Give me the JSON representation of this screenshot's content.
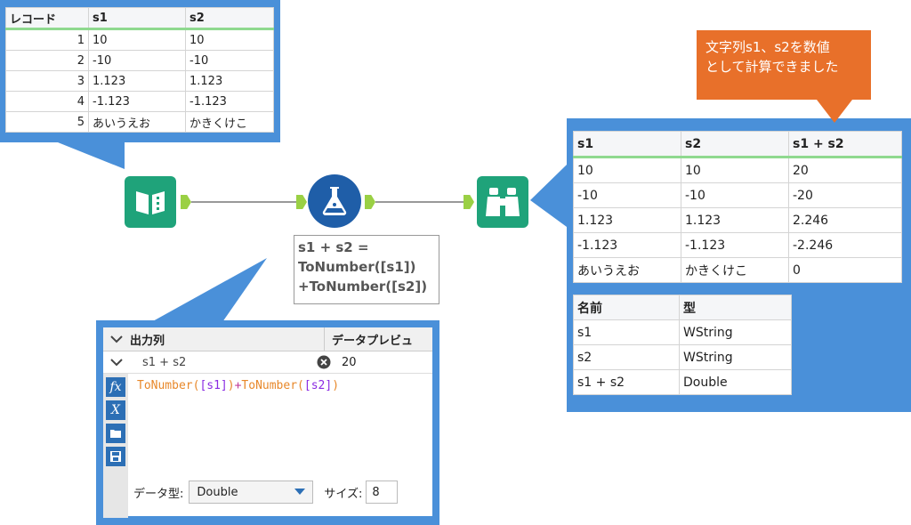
{
  "input_table": {
    "headers": [
      "レコード",
      "s1",
      "s2"
    ],
    "rows": [
      [
        "1",
        "10",
        "10"
      ],
      [
        "2",
        "-10",
        "-10"
      ],
      [
        "3",
        "1.123",
        "1.123"
      ],
      [
        "4",
        "-1.123",
        "-1.123"
      ],
      [
        "5",
        "あいうえお",
        "かきくけこ"
      ]
    ]
  },
  "output_table": {
    "headers": [
      "s1",
      "s2",
      "s1 + s2"
    ],
    "rows": [
      [
        "10",
        "10",
        "20"
      ],
      [
        "-10",
        "-10",
        "-20"
      ],
      [
        "1.123",
        "1.123",
        "2.246"
      ],
      [
        "-1.123",
        "-1.123",
        "-2.246"
      ],
      [
        "あいうえお",
        "かきくけこ",
        "0"
      ]
    ]
  },
  "schema_table": {
    "headers": [
      "名前",
      "型"
    ],
    "rows": [
      [
        "s1",
        "WString"
      ],
      [
        "s2",
        "WString"
      ],
      [
        "s1 + s2",
        "Double"
      ]
    ]
  },
  "annotation": {
    "lines": [
      "s1 + s2 =",
      "ToNumber([s1])",
      "+ToNumber([s2])"
    ]
  },
  "callout": {
    "lines": [
      "文字列s1、s2を数値",
      "として計算できました"
    ]
  },
  "formula_panel": {
    "col_output": "出力列",
    "col_preview": "データプレビュ",
    "field_name": "s1 + s2",
    "preview_value": "20",
    "expr_func1": "ToNumber(",
    "expr_arg1": "[s1]",
    "expr_close1": ")",
    "expr_plus": "+",
    "expr_func2": "ToNumber(",
    "expr_arg2": "[s2]",
    "expr_close2": ")",
    "datatype_label": "データ型:",
    "datatype_value": "Double",
    "size_label": "サイズ:",
    "size_value": "8"
  },
  "colors": {
    "frame_blue": "#4a90d9",
    "tool_green": "#1fa37a",
    "tool_blue": "#1f5ea8",
    "callout_orange": "#e8702a",
    "anchor_green": "#9ad044"
  }
}
